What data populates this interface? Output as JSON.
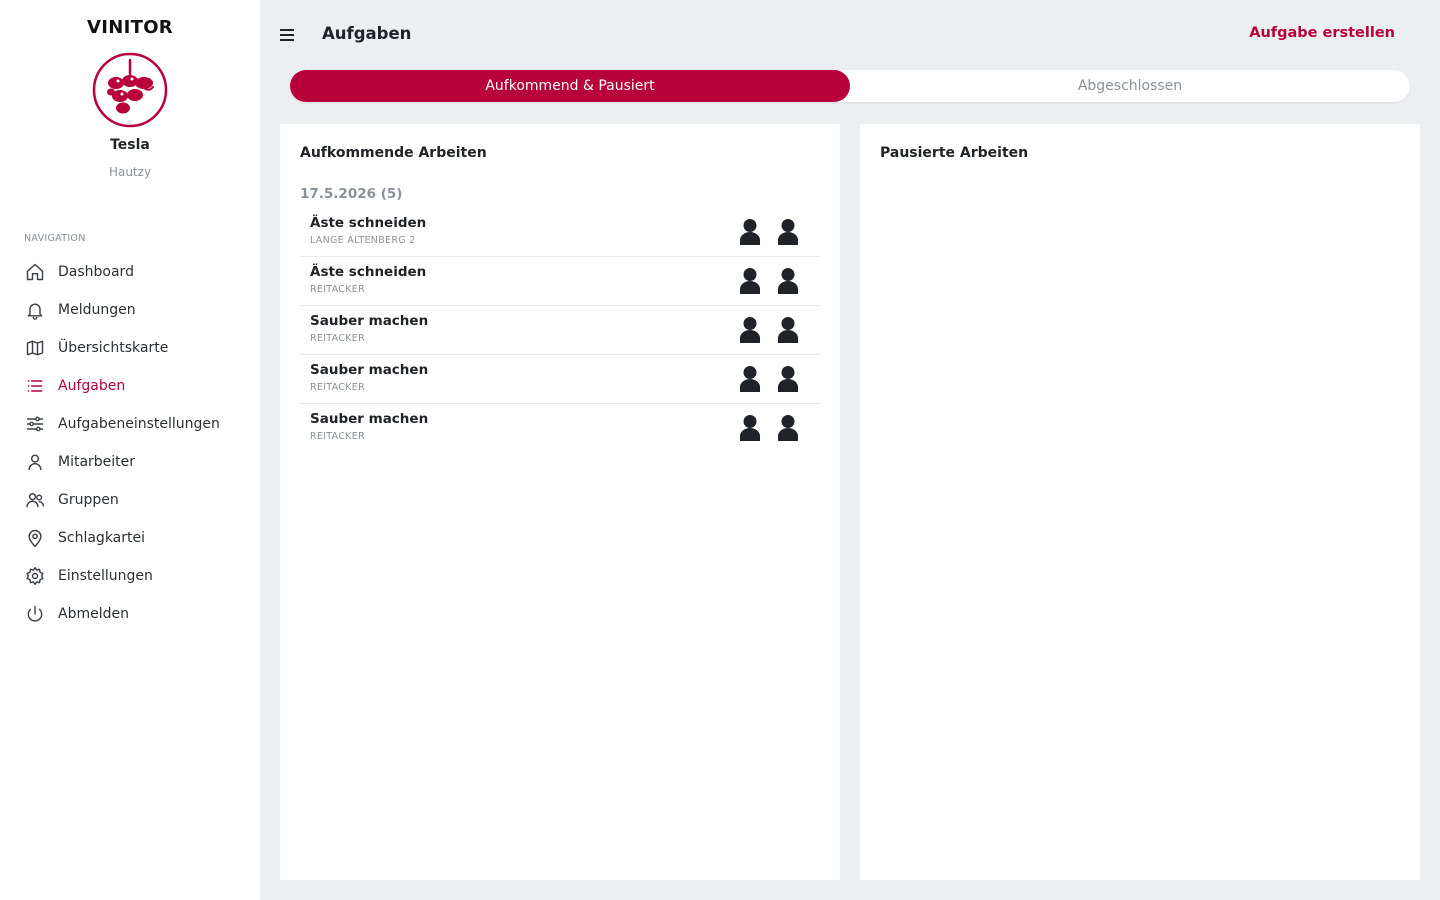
{
  "sidebar": {
    "brand": "VINITOR",
    "user_name": "Tesla",
    "user_sub": "Hautzy",
    "nav_label": "NAVIGATION",
    "items": [
      {
        "label": "Dashboard",
        "icon": "home-icon",
        "active": false
      },
      {
        "label": "Meldungen",
        "icon": "bell-icon",
        "active": false
      },
      {
        "label": "Übersichtskarte",
        "icon": "map-icon",
        "active": false
      },
      {
        "label": "Aufgaben",
        "icon": "list-icon",
        "active": true
      },
      {
        "label": "Aufgabeneinstellungen",
        "icon": "sliders-icon",
        "active": false
      },
      {
        "label": "Mitarbeiter",
        "icon": "user-icon",
        "active": false
      },
      {
        "label": "Gruppen",
        "icon": "users-icon",
        "active": false
      },
      {
        "label": "Schlagkartei",
        "icon": "map-pin-icon",
        "active": false
      },
      {
        "label": "Einstellungen",
        "icon": "gear-icon",
        "active": false
      },
      {
        "label": "Abmelden",
        "icon": "power-icon",
        "active": false
      }
    ]
  },
  "header": {
    "title": "Aufgaben",
    "create_label": "Aufgabe erstellen"
  },
  "tabs": [
    {
      "label": "Aufkommend & Pausiert",
      "active": true
    },
    {
      "label": "Abgeschlossen",
      "active": false
    }
  ],
  "panels": {
    "upcoming": {
      "title": "Aufkommende Arbeiten",
      "group_head": "17.5.2026 (5)",
      "tasks": [
        {
          "title": "Äste schneiden",
          "location": "LANGE ALTENBERG 2"
        },
        {
          "title": "Äste schneiden",
          "location": "REITACKER"
        },
        {
          "title": "Sauber machen",
          "location": "REITACKER"
        },
        {
          "title": "Sauber machen",
          "location": "REITACKER"
        },
        {
          "title": "Sauber machen",
          "location": "REITACKER"
        }
      ]
    },
    "paused": {
      "title": "Pausierte Arbeiten"
    }
  },
  "colors": {
    "accent": "#b8003b",
    "background": "#eceff2",
    "muted": "#8a9299"
  }
}
